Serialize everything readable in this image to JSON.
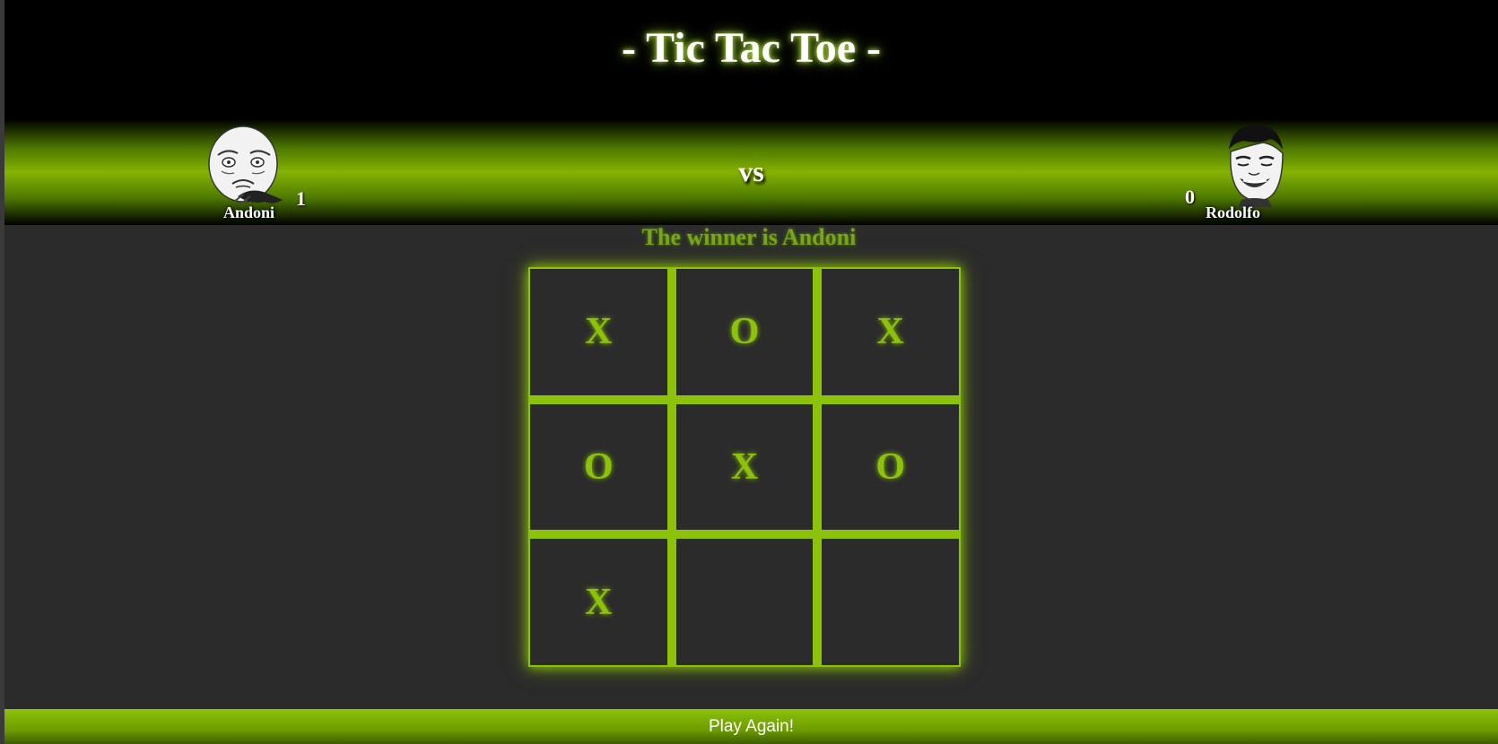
{
  "header": {
    "title": "- Tic Tac Toe -"
  },
  "players": {
    "left": {
      "name": "Andoni",
      "score": "1",
      "avatar_icon": "me-gusta-face-icon"
    },
    "vs": "vs",
    "right": {
      "name": "Rodolfo",
      "score": "0",
      "avatar_icon": "yao-ming-face-icon"
    }
  },
  "status": {
    "message": "The winner is Andoni"
  },
  "board": {
    "cells": [
      "X",
      "O",
      "X",
      "O",
      "X",
      "O",
      "X",
      "",
      ""
    ]
  },
  "footer": {
    "play_again_label": "Play Again!"
  },
  "colors": {
    "accent": "#8cc20a",
    "background": "#2b2b2b",
    "header_bg": "#000000",
    "status_text": "#7aa51a"
  }
}
